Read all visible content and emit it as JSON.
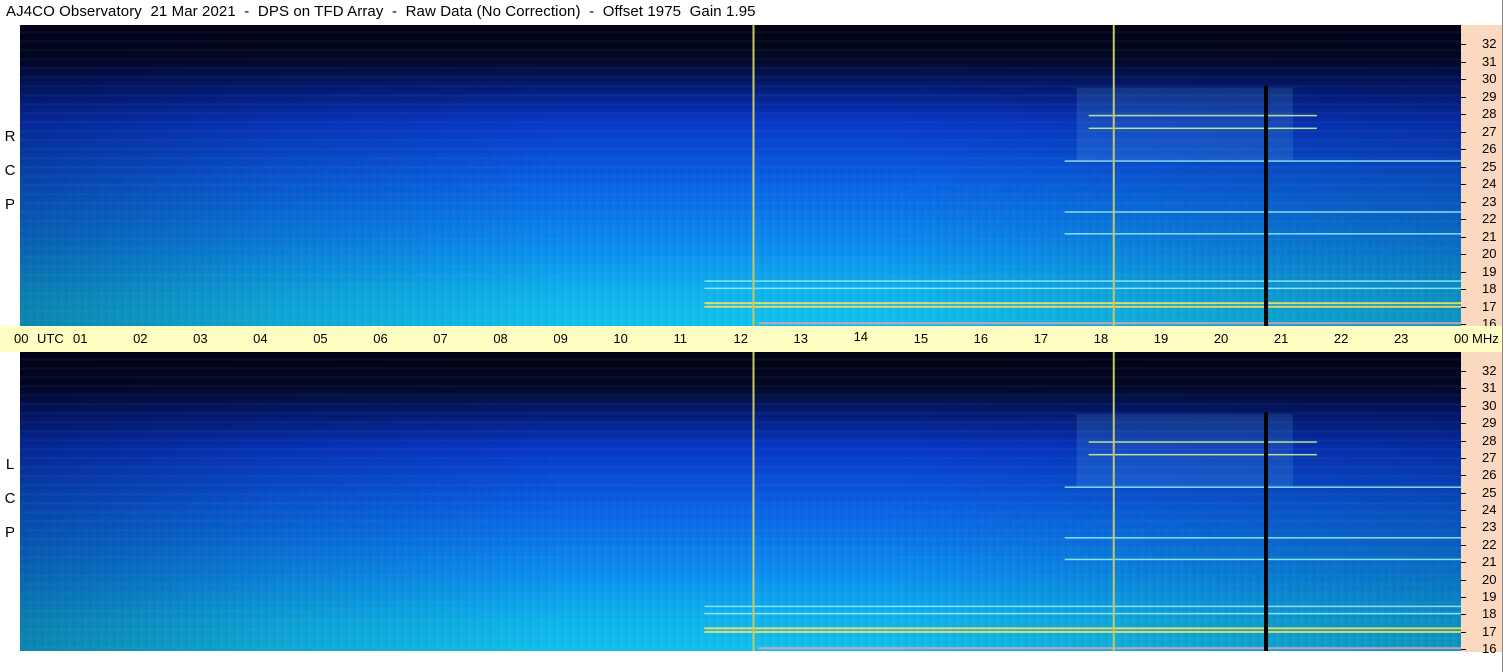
{
  "title": "AJ4CO Observatory  21 Mar 2021  -  DPS on TFD Array  -  Raw Data (No Correction)  -  Offset 1975  Gain 1.95",
  "panels": [
    {
      "id": "top",
      "polarization_label": "R C P"
    },
    {
      "id": "bottom",
      "polarization_label": "L C P"
    }
  ],
  "x_axis": {
    "unit_label": "UTC",
    "ticks": [
      "00",
      "01",
      "02",
      "03",
      "04",
      "05",
      "06",
      "07",
      "08",
      "09",
      "10",
      "11",
      "12",
      "13",
      "14",
      "15",
      "16",
      "17",
      "18",
      "19",
      "20",
      "21",
      "22",
      "23",
      "00"
    ],
    "range_hours": [
      0,
      24
    ]
  },
  "y_axis": {
    "unit_label": "MHz",
    "ticks": [
      "32",
      "31",
      "30",
      "29",
      "28",
      "27",
      "26",
      "25",
      "24",
      "23",
      "22",
      "21",
      "20",
      "19",
      "18",
      "17",
      "16"
    ],
    "range_mhz": [
      16,
      32
    ]
  },
  "colors": {
    "marker_line": "#c8c860",
    "gap_line": "#000000",
    "time_bar": "#ffffc3",
    "freq_strip": "#fbd9c1"
  },
  "chart_data": {
    "type": "heatmap",
    "title": "AJ4CO Observatory  21 Mar 2021  -  DPS on TFD Array  -  Raw Data (No Correction)  -  Offset 1975  Gain 1.95",
    "xlabel": "UTC",
    "ylabel": "MHz",
    "xlim": [
      0,
      24
    ],
    "ylim": [
      16,
      32
    ],
    "series": [
      {
        "name": "R C P"
      },
      {
        "name": "L C P"
      }
    ],
    "vertical_markers_hours": [
      12.2,
      18.2
    ],
    "data_gap_hours": [
      20.72
    ],
    "interference_bands_mhz": [
      17.0,
      17.2,
      18.0,
      18.4,
      21.0,
      22.2,
      25.0,
      26.8,
      27.5
    ]
  }
}
